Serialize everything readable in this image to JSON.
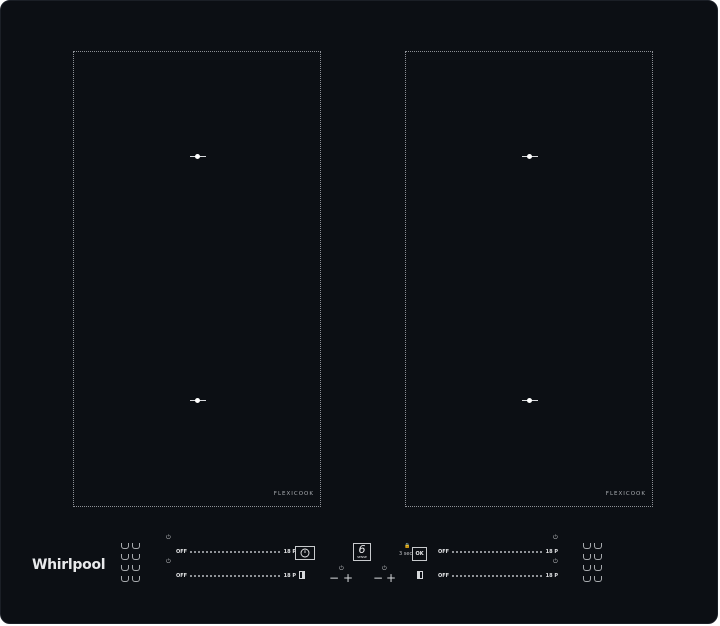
{
  "brand": "Whirlpool",
  "zones": {
    "left_label": "FLEXICOOK",
    "right_label": "FLEXICOOK"
  },
  "sliders": {
    "off_label": "OFF",
    "max_label": "18 P"
  },
  "center": {
    "timer_icon": "timer-icon",
    "boost_number": "6",
    "boost_subtext": "SENSE",
    "ok_label": "OK",
    "three_sec_label": "3 sec",
    "minus": "−",
    "plus": "+"
  },
  "colors": {
    "glass": "#0c0f14",
    "markings": "#8d9096",
    "text": "#e2e3e5"
  }
}
